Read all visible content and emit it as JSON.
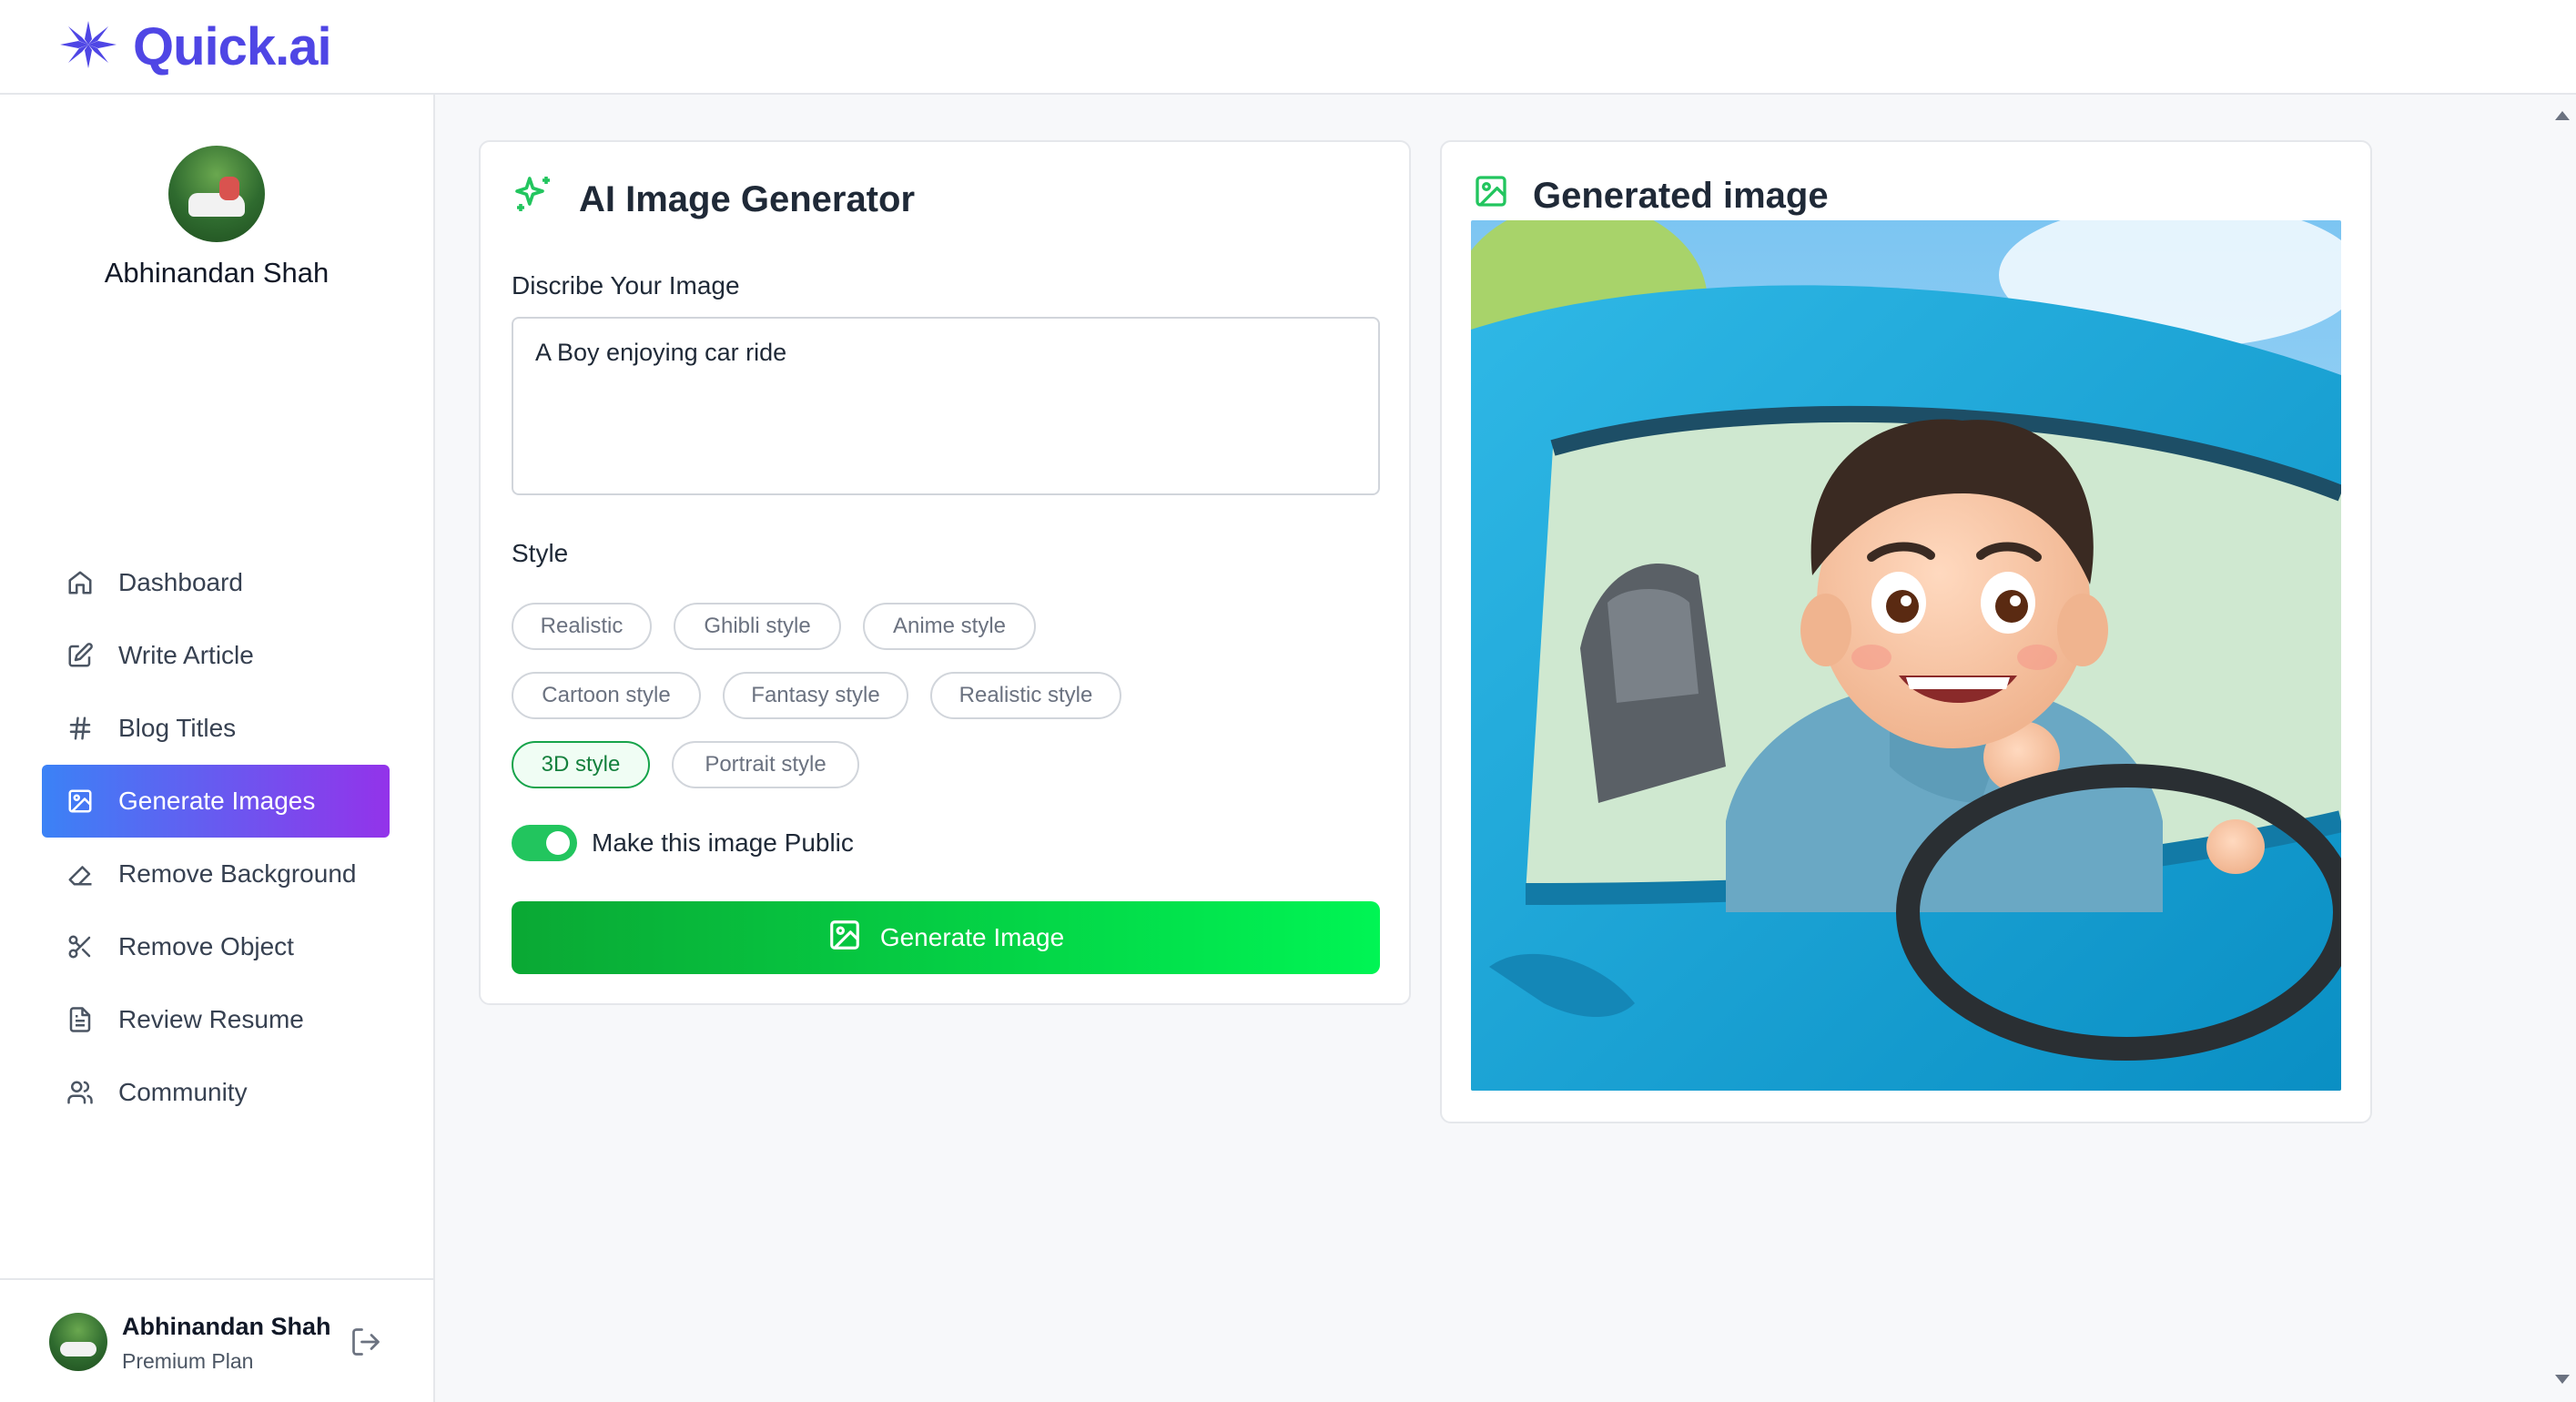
{
  "app": {
    "logo_text": "Quick.ai",
    "brand_color": "#4f46e5"
  },
  "sidebar": {
    "user_name": "Abhinandan Shah",
    "items": [
      {
        "label": "Dashboard",
        "icon": "home-icon"
      },
      {
        "label": "Write Article",
        "icon": "edit-icon"
      },
      {
        "label": "Blog Titles",
        "icon": "hash-icon"
      },
      {
        "label": "Generate Images",
        "icon": "image-icon",
        "active": true
      },
      {
        "label": "Remove Background",
        "icon": "eraser-icon"
      },
      {
        "label": "Remove Object",
        "icon": "scissors-icon"
      },
      {
        "label": "Review Resume",
        "icon": "file-text-icon"
      },
      {
        "label": "Community",
        "icon": "users-icon"
      }
    ],
    "footer": {
      "name": "Abhinandan Shah",
      "plan": "Premium Plan"
    }
  },
  "generator": {
    "title": "AI Image Generator",
    "description_label": "Discribe Your Image",
    "description_value": "A Boy enjoying car ride",
    "style_label": "Style",
    "styles": [
      "Realistic",
      "Ghibli style",
      "Anime style",
      "Cartoon style",
      "Fantasy style",
      "Realistic style",
      "3D style",
      "Portrait style"
    ],
    "selected_style": "3D style",
    "public_toggle_label": "Make this image Public",
    "public_toggle_on": true,
    "generate_button": "Generate Image",
    "accent_color": "#22c55e"
  },
  "result": {
    "title": "Generated image"
  }
}
